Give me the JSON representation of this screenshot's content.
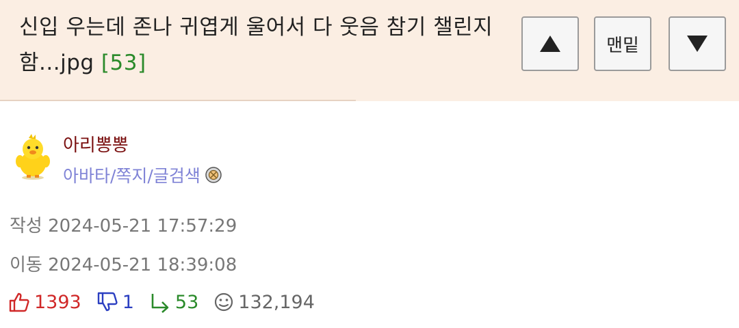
{
  "post": {
    "title": "신입 우는데 존나 귀엽게 울어서 다 웃음 참기 챌린지함...jpg",
    "comment_count": "[53]"
  },
  "nav": {
    "bottom_label": "맨밑"
  },
  "author": {
    "name": "아리뽕뽕",
    "links": "아바타/쪽지/글검색"
  },
  "meta": {
    "created": "작성 2024-05-21 17:57:29",
    "moved": "이동 2024-05-21 18:39:08"
  },
  "stats": {
    "likes": "1393",
    "dislikes": "1",
    "replies": "53",
    "views": "132,194"
  },
  "colors": {
    "header_bg": "#fbeee3",
    "like": "#d02828",
    "dislike": "#2b3fc1",
    "reply": "#2a8a2a",
    "author_name": "#7a0f0f",
    "author_links": "#7f83d6"
  },
  "icons": {
    "up": "triangle-up-icon",
    "down": "triangle-down-icon",
    "like": "thumbs-up-icon",
    "dislike": "thumbs-down-icon",
    "reply": "reply-arrow-icon",
    "views": "smiley-face-icon",
    "avatar": "yellow-chick-avatar",
    "badge": "member-badge-icon"
  }
}
